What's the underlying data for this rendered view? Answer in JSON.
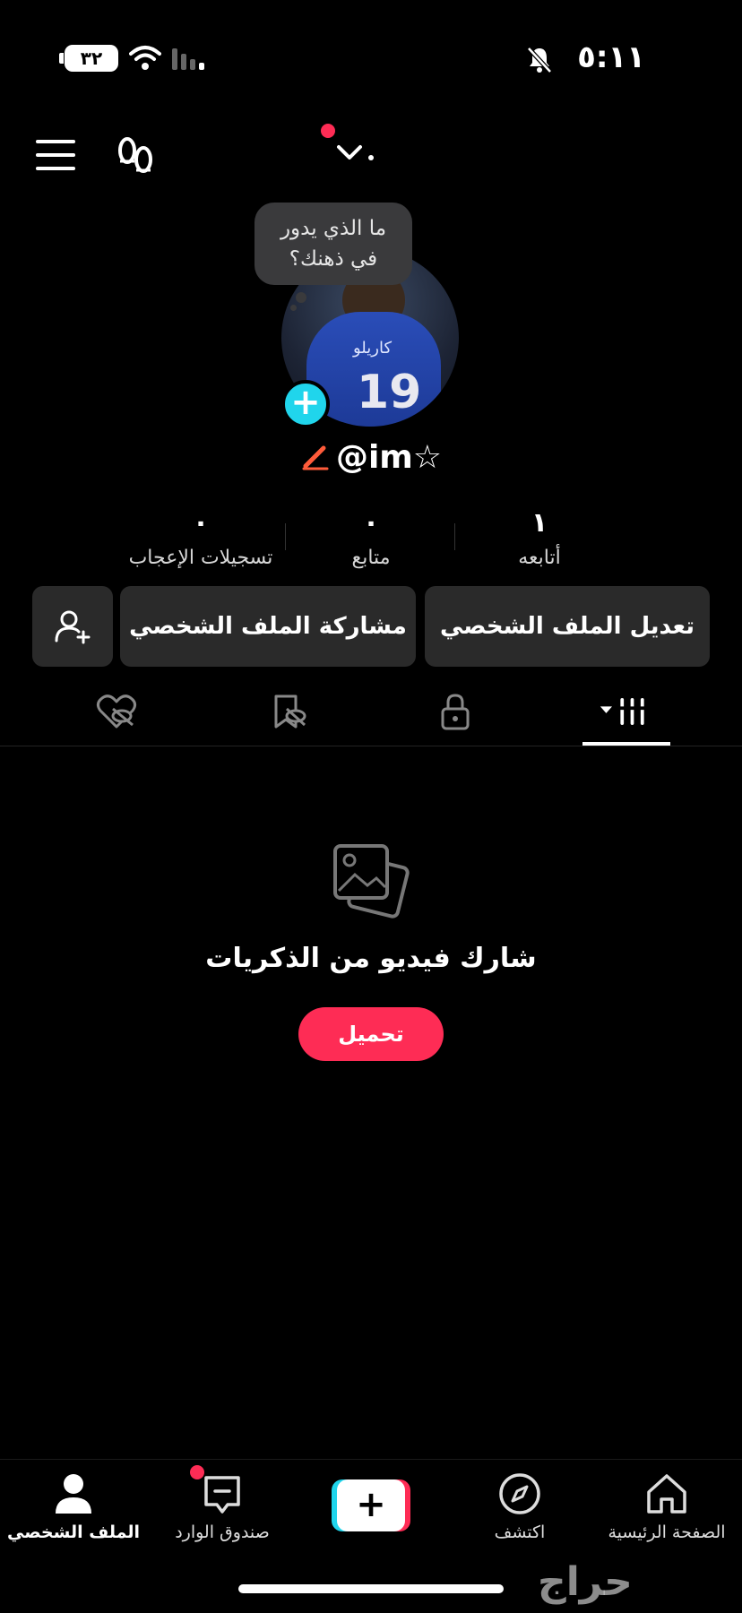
{
  "status_bar": {
    "time": "٥:١١",
    "battery": "٣٢"
  },
  "header": {
    "notification_dot_color": "#fe2c55"
  },
  "profile": {
    "bubble_line1": "ما الذي يدور",
    "bubble_line2": "في ذهنك؟",
    "jersey_number": "19",
    "jersey_name": "كاريلو",
    "username": "@im☆"
  },
  "stats": [
    {
      "value": "١",
      "label": "أتابعه"
    },
    {
      "value": "٠",
      "label": "متابع"
    },
    {
      "value": "٠",
      "label": "تسجيلات الإعجاب"
    }
  ],
  "actions": {
    "edit_profile": "تعديل الملف الشخصي",
    "share_profile": "مشاركة الملف الشخصي"
  },
  "empty_state": {
    "title": "شارك فيديو من الذكريات",
    "upload_label": "تحميل"
  },
  "bottom_nav": {
    "home": "الصفحة الرئيسية",
    "discover": "اكتشف",
    "create": "+",
    "inbox": "صندوق الوارد",
    "profile": "الملف الشخصي"
  },
  "watermark": "حراج",
  "colors": {
    "accent": "#fe2c55",
    "cyan": "#20d5ec",
    "surface": "#2a2a2a"
  }
}
